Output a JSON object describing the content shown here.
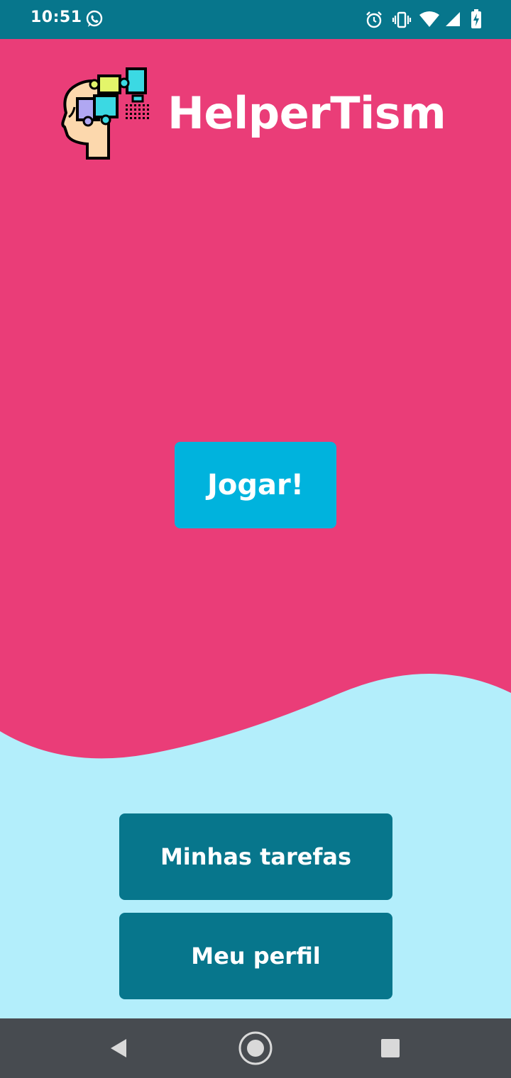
{
  "status_bar": {
    "time": "10:51",
    "left_icons": [
      "whatsapp-icon"
    ],
    "right_icons": [
      "alarm-icon",
      "vibrate-icon",
      "wifi-icon",
      "signal-icon",
      "battery-charging-icon"
    ]
  },
  "app": {
    "title": "HelperTism",
    "logo_icon": "head-puzzle-icon"
  },
  "main": {
    "play_button": "Jogar!",
    "tasks_button": "Minhas tarefas",
    "profile_button": "Meu perfil"
  },
  "colors": {
    "primary_pink": "#ea3d78",
    "accent_cyan": "#00b3dd",
    "dark_teal": "#07768c",
    "light_cyan": "#b3eefb",
    "nav_bar": "#474b50"
  },
  "nav_bar": {
    "icons": [
      "back-icon",
      "home-icon",
      "recents-icon"
    ]
  }
}
